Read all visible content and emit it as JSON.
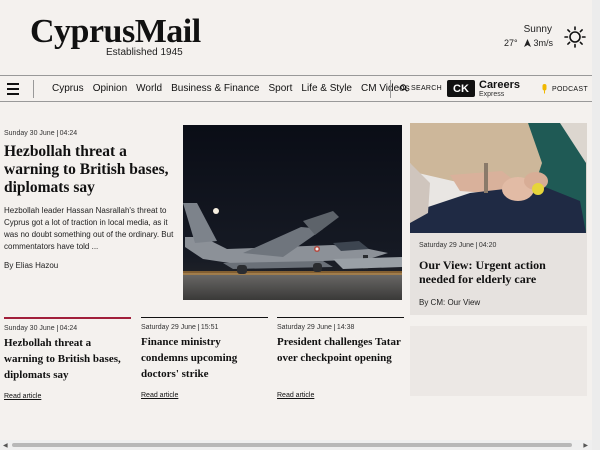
{
  "header": {
    "logo": "CyprusMail",
    "tagline": "Established 1945"
  },
  "weather": {
    "condition": "Sunny",
    "temperature": "27°",
    "wind": "3m/s",
    "icon": "sun-icon"
  },
  "nav": {
    "menu_icon": "hamburger-icon",
    "items": [
      "Cyprus",
      "Opinion",
      "World",
      "Business & Finance",
      "Sport",
      "Life & Style",
      "CM Videos"
    ],
    "search_label": "SEARCH",
    "careers_badge": "CK",
    "careers_title": "Careers",
    "careers_sub": "Express",
    "podcast_label": "PODCAST"
  },
  "lead": {
    "date": "Sunday 30 June",
    "time": "04:24",
    "title": "Hezbollah threat a warning to British bases, diplomats say",
    "excerpt": "Hezbollah leader Hassan Nasrallah's threat to Cyprus got a lot of traction in local media, as it was no doubt something out of the ordinary. But commentators have told ...",
    "byline": "By Elias Hazou"
  },
  "right_card": {
    "date": "Saturday 29 June",
    "time": "04:20",
    "title": "Our View: Urgent action needed for elderly care",
    "byline": "By CM: Our View"
  },
  "stories": [
    {
      "date": "Sunday 30 June",
      "time": "04:24",
      "title": "Hezbollah threat a warning to British bases, diplomats say",
      "read": "Read article"
    },
    {
      "date": "Saturday 29 June",
      "time": "15:51",
      "title": "Finance ministry condemns upcoming doctors' strike",
      "read": "Read article"
    },
    {
      "date": "Saturday 29 June",
      "time": "14:38",
      "title": "President challenges Tatar over checkpoint opening",
      "read": "Read article"
    }
  ],
  "colors": {
    "accent": "#a11f3a",
    "background": "#f4f1ee",
    "card": "#e6e2df"
  }
}
